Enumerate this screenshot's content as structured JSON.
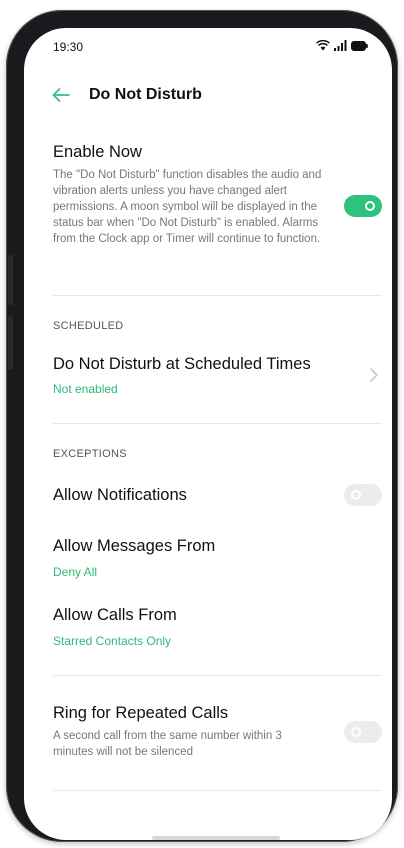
{
  "status_bar": {
    "time": "19:30",
    "icons": [
      "wifi-icon",
      "signal-icon",
      "battery-icon"
    ]
  },
  "header": {
    "back_icon": "arrow-left-icon",
    "title": "Do Not Disturb"
  },
  "enable_now": {
    "title": "Enable Now",
    "description": "The \"Do Not Disturb\" function disables the audio and vibration alerts unless you have changed alert permissions. A moon symbol will be displayed in the status bar when \"Do Not Disturb\" is enabled. Alarms from the Clock app or Timer will continue to function.",
    "enabled": true
  },
  "scheduled": {
    "section_label": "SCHEDULED",
    "title": "Do Not Disturb at Scheduled Times",
    "status": "Not enabled"
  },
  "exceptions": {
    "section_label": "EXCEPTIONS",
    "allow_notifications": {
      "title": "Allow Notifications",
      "enabled": false
    },
    "allow_messages": {
      "title": "Allow Messages From",
      "value": "Deny All"
    },
    "allow_calls": {
      "title": "Allow Calls From",
      "value": "Starred Contacts Only"
    }
  },
  "repeated_calls": {
    "title": "Ring for Repeated Calls",
    "description": "A second call from the same number within 3 minutes will not be silenced",
    "enabled": false
  },
  "colors": {
    "accent": "#2ec27e",
    "frame": "#1a1a1e"
  }
}
